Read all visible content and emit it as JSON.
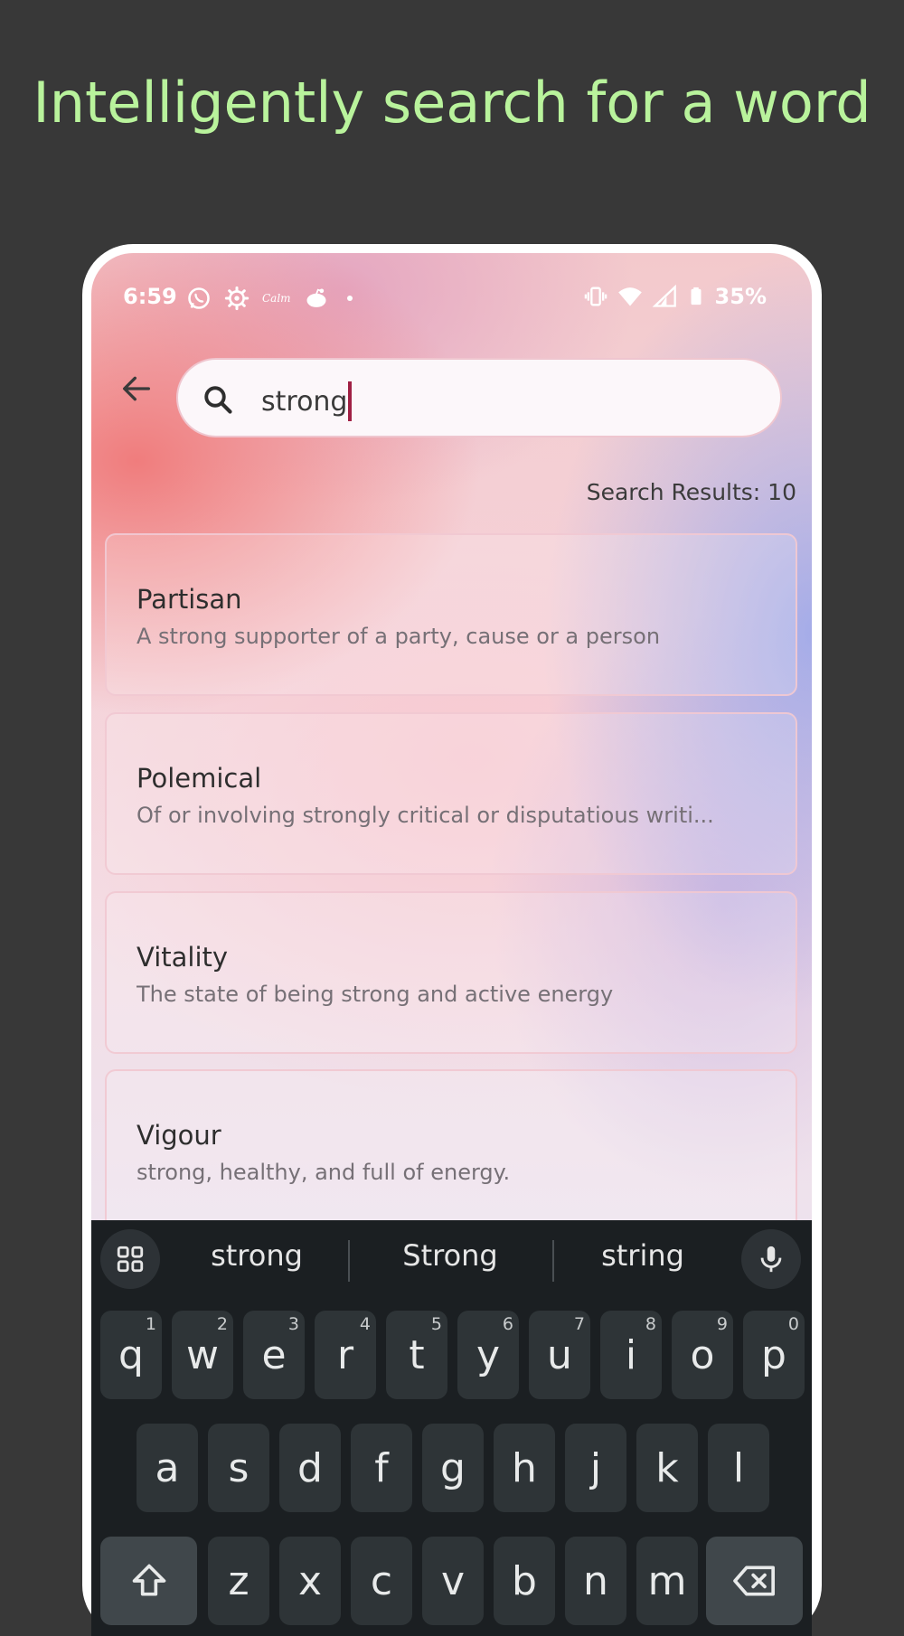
{
  "headline": "Intelligently search for a word",
  "status_bar": {
    "time": "6:59",
    "battery": "35%",
    "left_icons": [
      "whatsapp-icon",
      "gear-icon",
      "calm-icon",
      "reddit-icon",
      "dot-icon"
    ],
    "left_calm_text": "Calm",
    "right_icons": [
      "vibrate-icon",
      "wifi-icon",
      "signal-icon",
      "battery-icon"
    ]
  },
  "search": {
    "value": "strong"
  },
  "results_label": "Search Results: 10",
  "results": [
    {
      "word": "Partisan",
      "definition": "A strong supporter of a party, cause or a person"
    },
    {
      "word": "Polemical",
      "definition": "Of or involving strongly critical or disputatious writi..."
    },
    {
      "word": "Vitality",
      "definition": "The state of being strong and active energy"
    },
    {
      "word": "Vigour",
      "definition": "strong, healthy, and full of energy."
    }
  ],
  "keyboard": {
    "suggestions": [
      "strong",
      "Strong",
      "string"
    ],
    "row1": [
      {
        "key": "q",
        "num": "1"
      },
      {
        "key": "w",
        "num": "2"
      },
      {
        "key": "e",
        "num": "3"
      },
      {
        "key": "r",
        "num": "4"
      },
      {
        "key": "t",
        "num": "5"
      },
      {
        "key": "y",
        "num": "6"
      },
      {
        "key": "u",
        "num": "7"
      },
      {
        "key": "i",
        "num": "8"
      },
      {
        "key": "o",
        "num": "9"
      },
      {
        "key": "p",
        "num": "0"
      }
    ],
    "row2": [
      "a",
      "s",
      "d",
      "f",
      "g",
      "h",
      "j",
      "k",
      "l"
    ],
    "row3": [
      "z",
      "x",
      "c",
      "v",
      "b",
      "n",
      "m"
    ]
  },
  "colors": {
    "headline": "#b9f39c",
    "background": "#383838",
    "caret": "#a02044",
    "keyboard_bg": "#1b1f22",
    "key_bg": "#2e3437"
  }
}
